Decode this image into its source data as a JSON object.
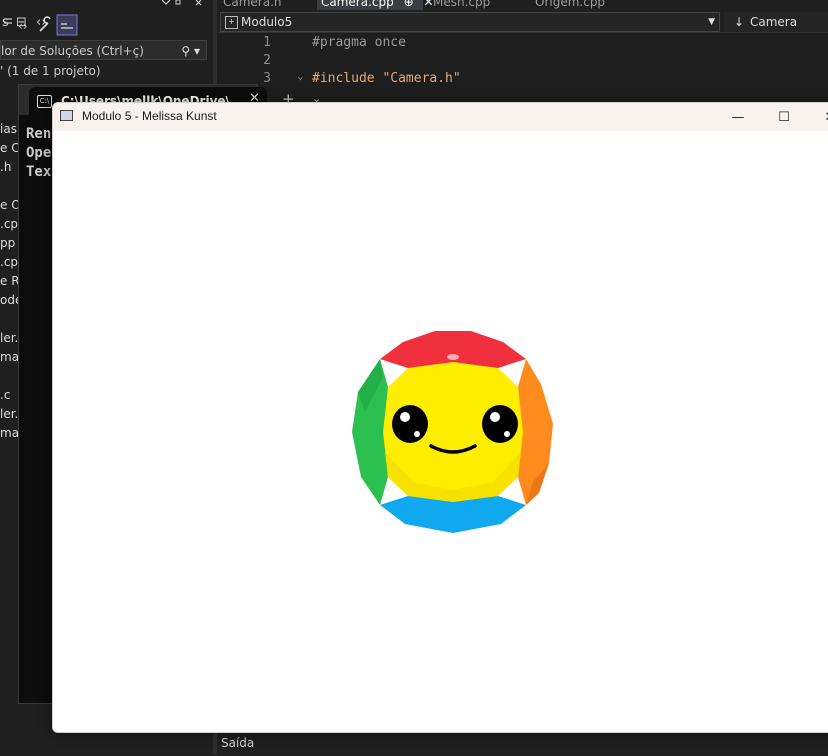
{
  "vs": {
    "tabs": [
      {
        "label": "Camera.h"
      },
      {
        "label": "Camera.cpp",
        "pin": "⊕",
        "close": "✕"
      },
      {
        "label": "Mesh.cpp"
      },
      {
        "label": "Origem.cpp"
      }
    ],
    "solution_explorer": {
      "search_placeholder": "lor de Soluções (Ctrl+ç)",
      "project_line": "' (1 de 1 projeto)",
      "tree_items": [
        "ias",
        "e Ca",
        ".h",
        "e Or",
        ".cpp",
        "pp",
        ".cpp",
        "e Re",
        "ode",
        "ler.l",
        "ma",
        ".c",
        "ler.c",
        "ma"
      ]
    },
    "nav": {
      "scope": "Modulo5",
      "member": "Camera"
    },
    "editor": {
      "lines": [
        {
          "num": "1",
          "text": "#pragma once"
        },
        {
          "num": "2",
          "text": ""
        },
        {
          "num": "3",
          "text": "#include \"Camera.h\""
        }
      ]
    },
    "output_label": "Saída"
  },
  "console": {
    "tab_title": "C:\\Users\\mellk\\OneDrive\\Doc",
    "lines": [
      "Ren",
      "Ope",
      "Tex"
    ]
  },
  "glwindow": {
    "title": "Modulo 5 - Melissa Kunst",
    "controls": {
      "minimize": "—",
      "maximize": "☐",
      "close": "✕"
    }
  },
  "colors": {
    "face_yellow": "#ffee00",
    "top_red": "#f0303c",
    "right_orange": "#ff8a1e",
    "bottom_blue": "#10a8ee",
    "left_green": "#2cc050"
  }
}
